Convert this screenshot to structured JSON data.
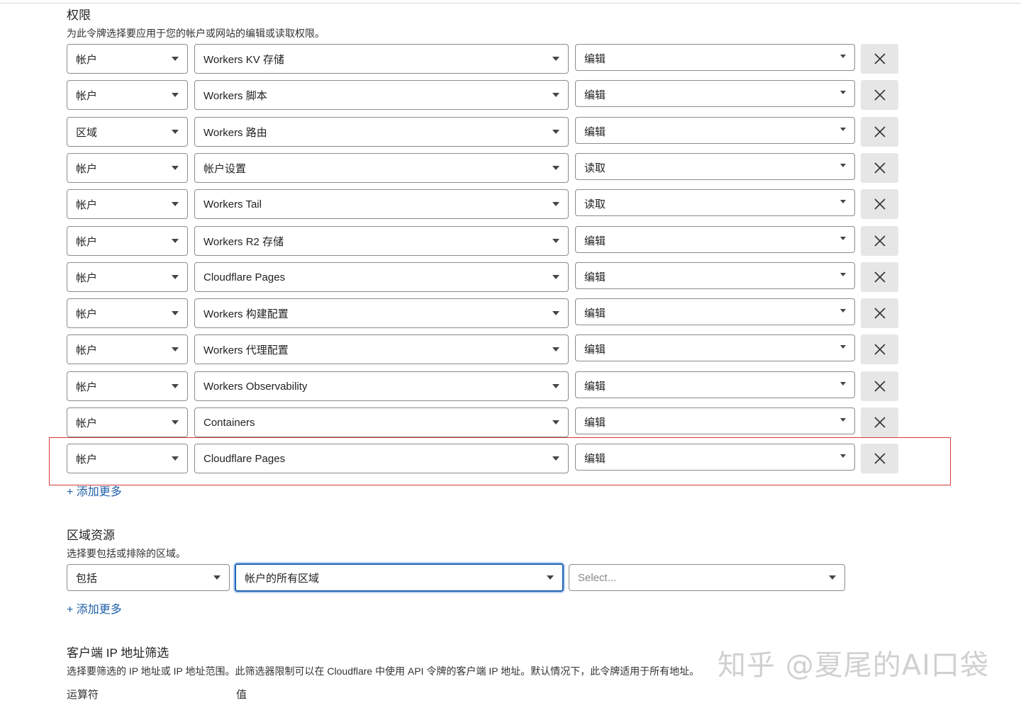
{
  "permissions": {
    "title": "权限",
    "description": "为此令牌选择要应用于您的帐户或网站的编辑或读取权限。",
    "rows": [
      {
        "scope": "帐户",
        "resource": "Workers KV 存储",
        "access": "编辑"
      },
      {
        "scope": "帐户",
        "resource": "Workers 脚本",
        "access": "编辑"
      },
      {
        "scope": "区域",
        "resource": "Workers 路由",
        "access": "编辑"
      },
      {
        "scope": "帐户",
        "resource": "帐户设置",
        "access": "读取"
      },
      {
        "scope": "帐户",
        "resource": "Workers Tail",
        "access": "读取"
      },
      {
        "scope": "帐户",
        "resource": "Workers R2 存储",
        "access": "编辑"
      },
      {
        "scope": "帐户",
        "resource": "Cloudflare Pages",
        "access": "编辑"
      },
      {
        "scope": "帐户",
        "resource": "Workers 构建配置",
        "access": "编辑"
      },
      {
        "scope": "帐户",
        "resource": "Workers 代理配置",
        "access": "编辑"
      },
      {
        "scope": "帐户",
        "resource": "Workers Observability",
        "access": "编辑"
      },
      {
        "scope": "帐户",
        "resource": "Containers",
        "access": "编辑"
      },
      {
        "scope": "帐户",
        "resource": "Cloudflare Pages",
        "access": "编辑"
      }
    ],
    "add_more": "+ 添加更多"
  },
  "zone_resources": {
    "title": "区域资源",
    "description": "选择要包括或排除的区域。",
    "include": "包括",
    "target": "帐户的所有区域",
    "placeholder": "Select...",
    "add_more": "+ 添加更多"
  },
  "client_ip": {
    "title": "客户端 IP 地址筛选",
    "description": "选择要筛选的 IP 地址或 IP 地址范围。此筛选器限制可以在 Cloudflare 中使用 API 令牌的客户端 IP 地址。默认情况下，此令牌适用于所有地址。",
    "operator_label": "运算符",
    "value_label": "值"
  },
  "watermark": "知乎 @夏尾的AI口袋",
  "icons": {
    "remove": "close-icon",
    "dropdown": "caret-down-icon"
  },
  "colors": {
    "link": "#1f5fa8",
    "highlight_border": "#d43a3a",
    "focus": "#1e61b4"
  }
}
